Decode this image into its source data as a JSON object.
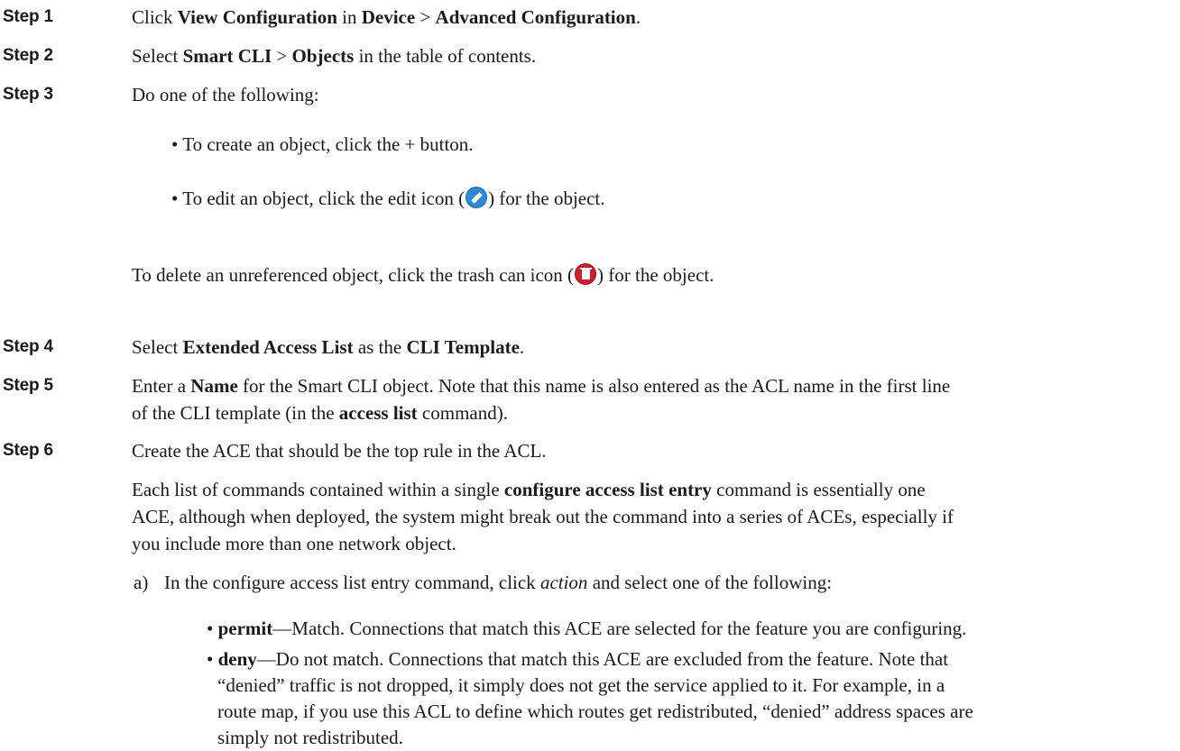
{
  "step1": {
    "label": "Step 1",
    "t1": "Click ",
    "b1": "View Configuration",
    "t2": " in ",
    "b2": "Device",
    "t3": " > ",
    "b3": "Advanced Configuration",
    "t4": "."
  },
  "step2": {
    "label": "Step 2",
    "t1": "Select ",
    "b1": "Smart CLI",
    "t2": " > ",
    "b2": "Objects",
    "t3": " in the table of contents."
  },
  "step3": {
    "label": "Step 3",
    "text": "Do one of the following:",
    "bullet1": "• To create an object, click the + button.",
    "bullet2_pre": "• To edit an object, click the edit icon (",
    "bullet2_post": ") for the object.",
    "delete_pre": "To delete an unreferenced object, click the trash can icon (",
    "delete_post": ") for the object."
  },
  "step4": {
    "label": "Step 4",
    "t1": "Select ",
    "b1": "Extended Access List",
    "t2": " as the ",
    "b2": "CLI Template",
    "t3": "."
  },
  "step5": {
    "label": "Step 5",
    "t1": "Enter a ",
    "b1": "Name",
    "t2": " for the Smart CLI object. Note that this name is also entered as the ACL name in the first line",
    "t3": "of the CLI template (in the ",
    "b2": "access list",
    "t4": " command)."
  },
  "step6": {
    "label": "Step 6",
    "text": "Create the ACE that should be the top rule in the ACL.",
    "p_line1_pre": "Each list of commands contained within a single ",
    "p_line1_bold": "configure access list entry",
    "p_line1_post": " command is essentially one",
    "p_line2": "ACE, although when deployed, the system might break out the command into a series of ACEs, especially if",
    "p_line3": "you include more than one network object.",
    "sub_a_marker": "a)",
    "sub_a_pre": "In the configure access list entry command, click ",
    "sub_a_italic": "action",
    "sub_a_post": " and select one of the following:",
    "permit_bullet": "• ",
    "permit_bold": "permit",
    "permit_text": "—Match. Connections that match this ACE are selected for the feature you are configuring.",
    "deny_bullet": "• ",
    "deny_bold": "deny",
    "deny_line1": "—Do not match. Connections that match this ACE are excluded from the feature. Note that",
    "deny_line2": "“denied” traffic is not dropped, it simply does not get the service applied to it. For example, in a",
    "deny_line3": "route map, if you use this ACL to define which routes get redistributed, “denied” address spaces are",
    "deny_line4": "simply not redistributed."
  },
  "icons": {
    "edit": "edit-icon",
    "trash": "trash-can-icon",
    "edit_color": "#2a8ad6",
    "trash_color": "#cf1d2b"
  }
}
